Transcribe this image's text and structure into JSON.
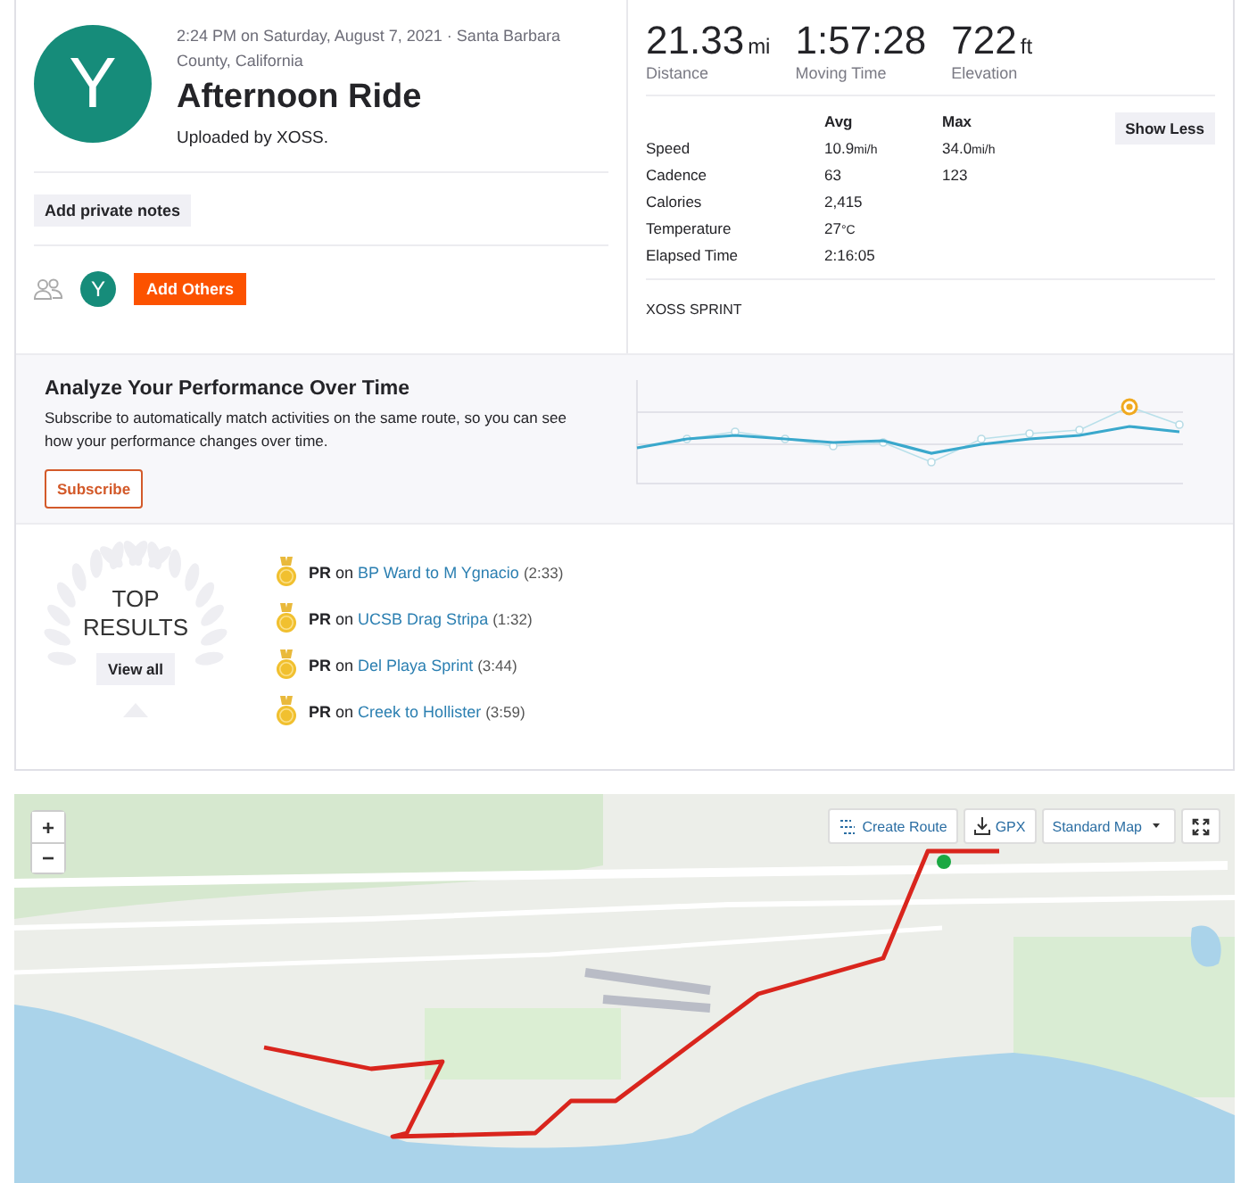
{
  "activity": {
    "avatar_letter": "Y",
    "meta": "2:24 PM on Saturday, August 7, 2021 · Santa Barbara County, California",
    "title": "Afternoon Ride",
    "uploader": "Uploaded by XOSS.",
    "notes_button": "Add private notes",
    "athlete_letter": "Y",
    "add_others_button": "Add Others"
  },
  "stats": {
    "primary": [
      {
        "value": "21.33",
        "unit": "mi",
        "label": "Distance"
      },
      {
        "value": "1:57:28",
        "label": "Moving Time"
      },
      {
        "value": "722",
        "unit": "ft",
        "label": "Elevation"
      }
    ],
    "headers": [
      "Avg",
      "Max"
    ],
    "rows": [
      {
        "label": "Speed",
        "avg": "10.9",
        "avg_unit": "mi/h",
        "max": "34.0",
        "max_unit": "mi/h"
      },
      {
        "label": "Cadence",
        "avg": "63",
        "max": "123"
      },
      {
        "label": "Calories",
        "avg": "2,415"
      },
      {
        "label": "Temperature",
        "avg": "27",
        "avg_unit": "°C"
      },
      {
        "label": "Elapsed Time",
        "avg": "2:16:05"
      }
    ],
    "toggle_button": "Show Less",
    "device": "XOSS SPRINT"
  },
  "analyze": {
    "title": "Analyze Your Performance Over Time",
    "text": "Subscribe to automatically match activities on the same route, so you can see how your performance changes over time.",
    "button": "Subscribe"
  },
  "top_results": {
    "title_lines": [
      "TOP",
      "RESULTS"
    ],
    "view_all": "View all",
    "items": [
      {
        "lead": "**PR** on",
        "segment": "BP Ward to M Ygnacio",
        "time": "(2:33)"
      },
      {
        "lead": "**PR** on",
        "segment": "UCSB Drag Stripa",
        "time": "(1:32)"
      },
      {
        "lead": "**PR** on",
        "segment": "Del Playa Sprint",
        "time": "(3:44)"
      },
      {
        "lead": "**PR** on",
        "segment": "Creek to Hollister",
        "time": "(3:59)"
      }
    ]
  },
  "map": {
    "zoom_in": "+",
    "zoom_out": "−",
    "create_route": "Create Route",
    "gpx": "GPX",
    "map_style": "Standard Map"
  }
}
